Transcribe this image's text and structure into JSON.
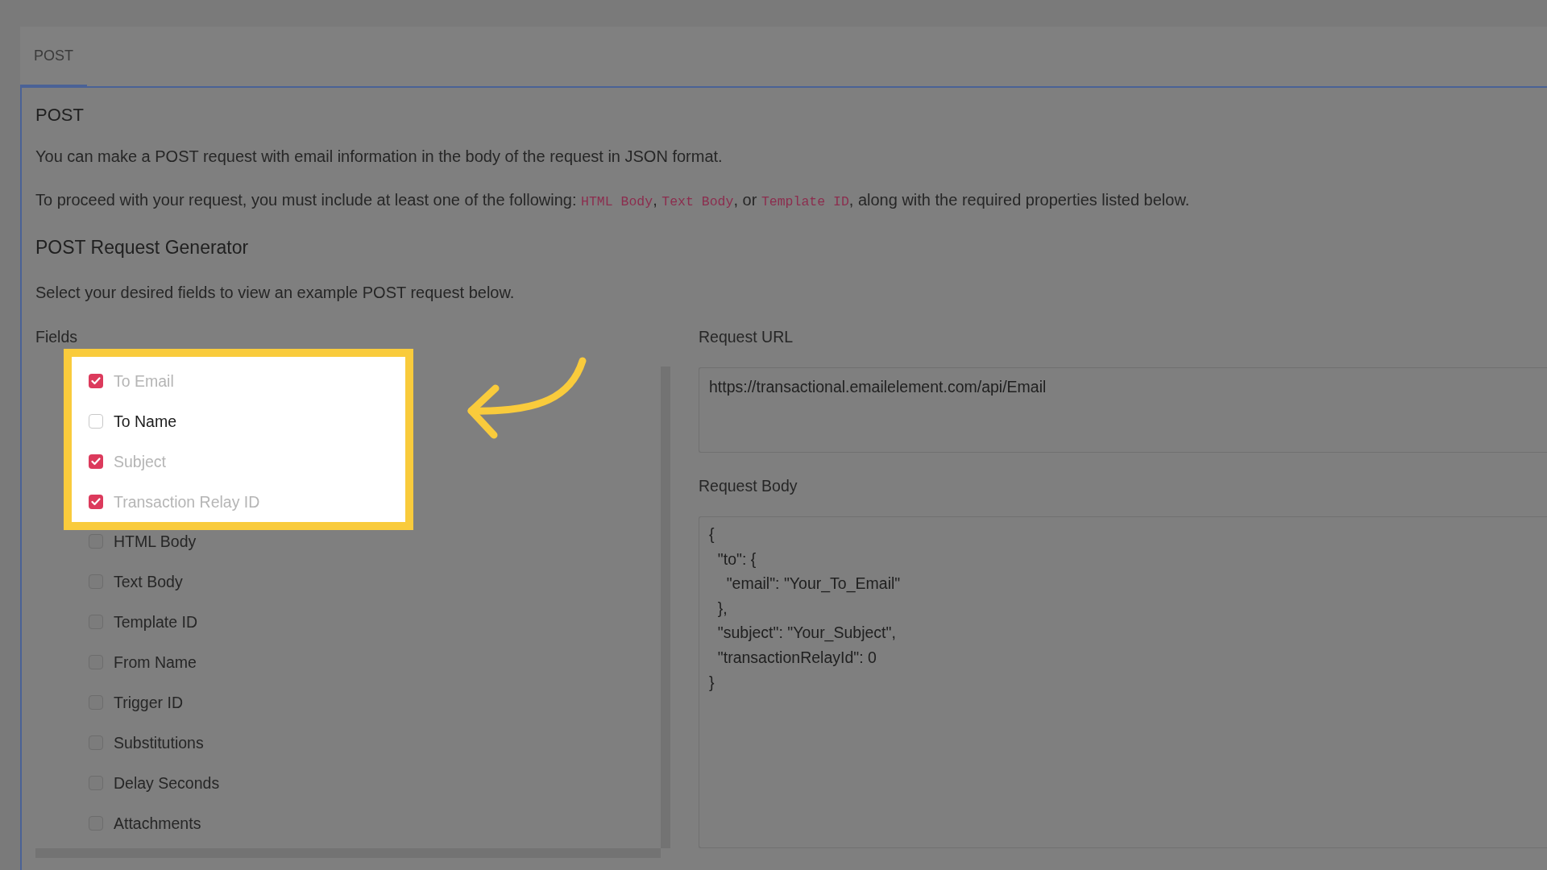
{
  "tabs": [
    {
      "label": "POST",
      "selected": true
    }
  ],
  "panel": {
    "title": "POST",
    "intro": "You can make a POST request with email information in the body of the request in JSON format.",
    "requirement": [
      {
        "kind": "plain",
        "text": "To proceed with your request, you must include at least one of the following: "
      },
      {
        "kind": "code",
        "text": "HTML Body"
      },
      {
        "kind": "plain",
        "text": ", "
      },
      {
        "kind": "code",
        "text": "Text Body"
      },
      {
        "kind": "plain",
        "text": ", or "
      },
      {
        "kind": "code",
        "text": "Template ID"
      },
      {
        "kind": "plain",
        "text": ", along with the required properties listed below."
      }
    ],
    "generator_title": "POST Request Generator",
    "generator_hint": "Select your desired fields to view an example POST request below."
  },
  "fields": {
    "label": "Fields",
    "items": [
      {
        "label": "To Email",
        "checked": true,
        "highlighted": true
      },
      {
        "label": "To Name",
        "checked": false,
        "highlighted": true
      },
      {
        "label": "Subject",
        "checked": true,
        "highlighted": true
      },
      {
        "label": "Transaction Relay ID",
        "checked": true,
        "highlighted": true
      },
      {
        "label": "HTML Body",
        "checked": false,
        "highlighted": false
      },
      {
        "label": "Text Body",
        "checked": false,
        "highlighted": false
      },
      {
        "label": "Template ID",
        "checked": false,
        "highlighted": false
      },
      {
        "label": "From Name",
        "checked": false,
        "highlighted": false
      },
      {
        "label": "Trigger ID",
        "checked": false,
        "highlighted": false
      },
      {
        "label": "Substitutions",
        "checked": false,
        "highlighted": false
      },
      {
        "label": "Delay Seconds",
        "checked": false,
        "highlighted": false
      },
      {
        "label": "Attachments",
        "checked": false,
        "highlighted": false
      }
    ]
  },
  "request": {
    "url_label": "Request URL",
    "url": "https://transactional.emailelement.com/api/Email",
    "body_label": "Request Body",
    "body": "{\n  \"to\": {\n    \"email\": \"Your_To_Email\"\n  },\n  \"subject\": \"Your_Subject\",\n  \"transactionRelayId\": 0\n}"
  }
}
